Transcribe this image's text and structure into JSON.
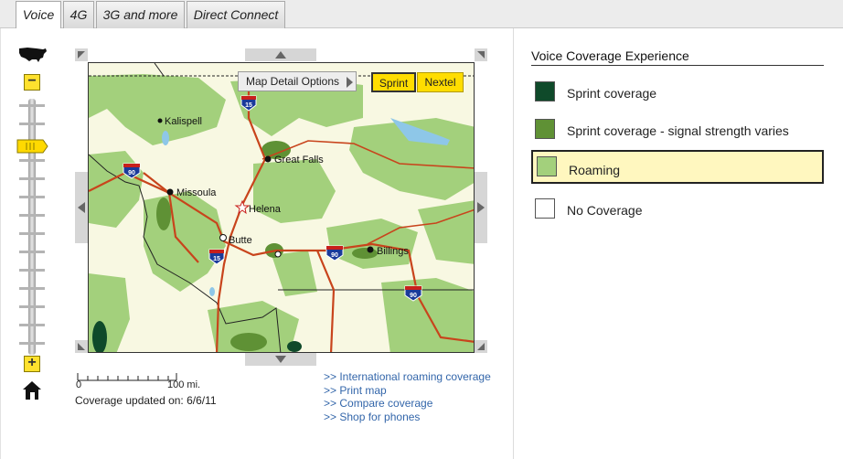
{
  "tabs": [
    {
      "label": "Voice",
      "active": true
    },
    {
      "label": "4G",
      "active": false
    },
    {
      "label": "3G and more",
      "active": false
    },
    {
      "label": "Direct Connect",
      "active": false
    }
  ],
  "zoom": {
    "in_label": "+",
    "out_label": "−"
  },
  "map": {
    "detail_button": "Map Detail Options",
    "provider_sprint": "Sprint",
    "provider_nextel": "Nextel",
    "cities": [
      {
        "name": "Kalispell"
      },
      {
        "name": "Great Falls"
      },
      {
        "name": "Missoula"
      },
      {
        "name": "Helena"
      },
      {
        "name": "Butte"
      },
      {
        "name": "Billings"
      }
    ],
    "highways": {
      "i15": "15",
      "i90": "90"
    }
  },
  "scale": {
    "start": "0",
    "end": "100",
    "unit": "mi."
  },
  "coverage_updated": "Coverage updated on: 6/6/11",
  "links": [
    ">> International roaming coverage",
    ">> Print map",
    ">> Compare coverage",
    ">> Shop for phones"
  ],
  "legend": {
    "title": "Voice Coverage Experience",
    "items": [
      {
        "label": "Sprint coverage",
        "color": "#0f4a2a",
        "selected": false
      },
      {
        "label": "Sprint coverage - signal strength varies",
        "color": "#5f9135",
        "selected": false
      },
      {
        "label": "Roaming",
        "color": "#a3d07c",
        "selected": true
      },
      {
        "label": "No Coverage",
        "color": "#ffffff",
        "selected": false
      }
    ]
  },
  "colors": {
    "accent": "#ffdd00",
    "link": "#3366aa",
    "coverage_light": "#a3d07c",
    "road": "#c8441c"
  }
}
